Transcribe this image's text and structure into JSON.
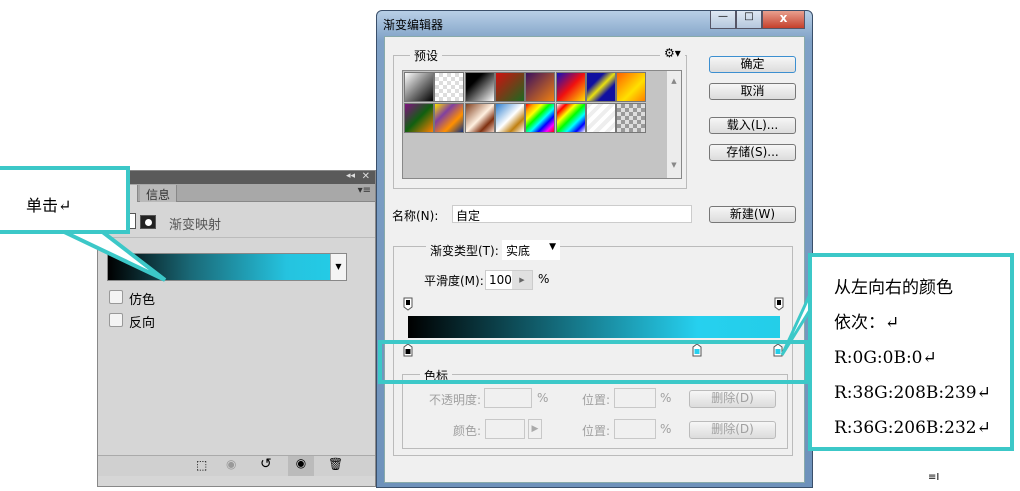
{
  "panel": {
    "tab_info": "信息",
    "adjustment_title": "渐变映射",
    "dither": "仿色",
    "reverse": "反向",
    "collapse": "◂◂",
    "close": "✕",
    "menu": "▾≡"
  },
  "callout_left": {
    "text": "单击↵"
  },
  "dialog": {
    "title": "渐变编辑器",
    "presets_label": "预设",
    "ok": "确定",
    "cancel": "取消",
    "load": "载入(L)...",
    "save": "存储(S)...",
    "name_label": "名称(N):",
    "name_value": "自定",
    "new": "新建(W)",
    "type_label": "渐变类型(T):",
    "type_value": "实底",
    "smooth_label": "平滑度(M):",
    "smooth_value": "100",
    "percent": "%",
    "stops_label": "色标",
    "opacity_label": "不透明度:",
    "color_label": "颜色:",
    "location_label": "位置:",
    "delete": "删除(D)"
  },
  "gradient": {
    "stops": [
      {
        "color": "#000000",
        "pos": 0
      },
      {
        "color": "#26d0ef",
        "pos": 78
      },
      {
        "color": "#24cee8",
        "pos": 100
      }
    ]
  },
  "callout_right": {
    "lines": [
      "从左向右的颜色",
      "依次：↵",
      "R:0G:0B:0↵",
      "R:38G:208B:239↵",
      "R:36G:206B:232↵"
    ]
  },
  "colors": {
    "accent": "#3cc8c8"
  }
}
